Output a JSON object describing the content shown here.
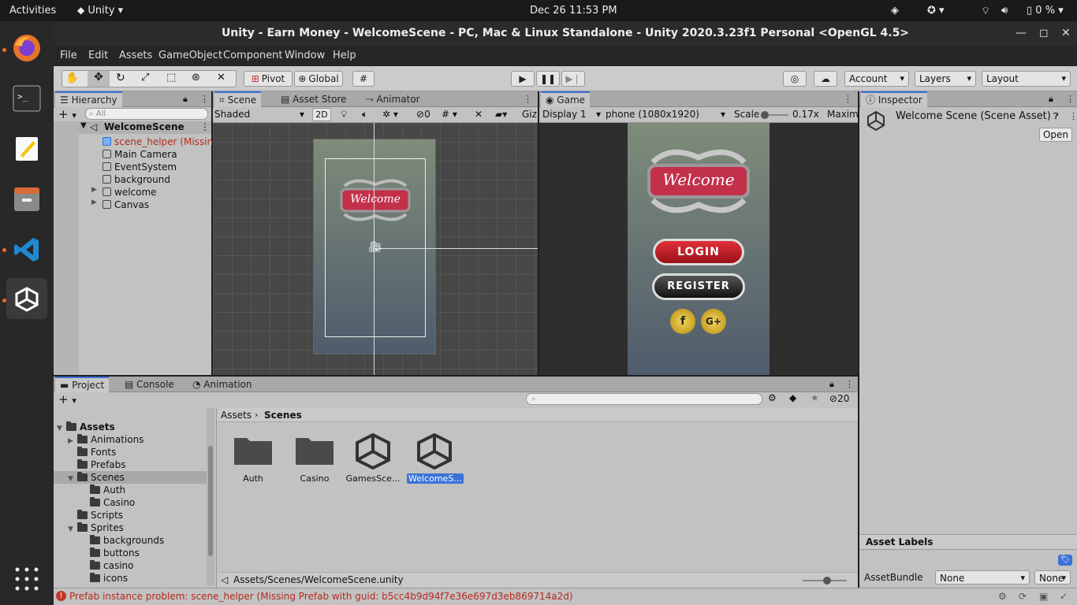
{
  "topbar": {
    "activities": "Activities",
    "app_name": "Unity",
    "clock": "Dec 26  11:53 PM",
    "battery": "0 %"
  },
  "window": {
    "title": "Unity - Earn Money - WelcomeScene - PC, Mac & Linux Standalone - Unity 2020.3.23f1 Personal <OpenGL 4.5>"
  },
  "menu": [
    "File",
    "Edit",
    "Assets",
    "GameObject",
    "Component",
    "Window",
    "Help"
  ],
  "toolbar": {
    "pivot": "Pivot",
    "global": "Global",
    "account": "Account",
    "layers": "Layers",
    "layout": "Layout"
  },
  "hierarchy": {
    "tab": "Hierarchy",
    "search_placeholder": "All",
    "scene": "WelcomeScene",
    "items": [
      {
        "label": "scene_helper (Missing",
        "missing": true
      },
      {
        "label": "Main Camera"
      },
      {
        "label": "EventSystem"
      },
      {
        "label": "background"
      },
      {
        "label": "welcome"
      },
      {
        "label": "Canvas"
      }
    ]
  },
  "scene_view": {
    "tabs": [
      "Scene",
      "Asset Store",
      "Animator"
    ],
    "shading": "Shaded",
    "mode_2d": "2D",
    "hidden_count": "0",
    "gizmos": "Giz",
    "welcome_text": "Welcome"
  },
  "game_view": {
    "tab": "Game",
    "display": "Display 1",
    "resolution": "phone (1080x1920)",
    "scale_label": "Scale",
    "scale_value": "0.17x",
    "maximize": "Maximi",
    "welcome_text": "Welcome",
    "login": "LOGIN",
    "register": "REGISTER",
    "fb": "f",
    "gplus": "G+"
  },
  "inspector": {
    "tab": "Inspector",
    "title": "Welcome Scene (Scene Asset)",
    "open": "Open",
    "asset_labels": "Asset Labels",
    "asset_bundle": "AssetBundle",
    "bundle_value": "None",
    "variant_value": "None"
  },
  "project": {
    "tabs": [
      "Project",
      "Console",
      "Animation"
    ],
    "hidden_count": "20",
    "breadcrumb": [
      "Assets",
      "Scenes"
    ],
    "tree": [
      {
        "label": "Assets",
        "depth": 0,
        "bold": true,
        "expanded": true
      },
      {
        "label": "Animations",
        "depth": 1,
        "arrow": true
      },
      {
        "label": "Fonts",
        "depth": 1
      },
      {
        "label": "Prefabs",
        "depth": 1
      },
      {
        "label": "Scenes",
        "depth": 1,
        "expanded": true,
        "selected": true
      },
      {
        "label": "Auth",
        "depth": 2
      },
      {
        "label": "Casino",
        "depth": 2
      },
      {
        "label": "Scripts",
        "depth": 1
      },
      {
        "label": "Sprites",
        "depth": 1,
        "expanded": true
      },
      {
        "label": "backgrounds",
        "depth": 2
      },
      {
        "label": "buttons",
        "depth": 2
      },
      {
        "label": "casino",
        "depth": 2
      },
      {
        "label": "icons",
        "depth": 2
      }
    ],
    "assets": [
      {
        "label": "Auth",
        "kind": "folder"
      },
      {
        "label": "Casino",
        "kind": "folder"
      },
      {
        "label": "GamesSce...",
        "kind": "unity"
      },
      {
        "label": "WelcomeS...",
        "kind": "unity",
        "selected": true
      }
    ],
    "path": "Assets/Scenes/WelcomeScene.unity"
  },
  "status": {
    "message": "Prefab instance problem: scene_helper (Missing Prefab with guid: b5cc4b9d94f7e36e697d3eb869714a2d)"
  },
  "colors": {
    "accent": "#3a72d8",
    "error": "#c0392b",
    "login_red": "#c81e28",
    "gold": "#d9b22a"
  }
}
